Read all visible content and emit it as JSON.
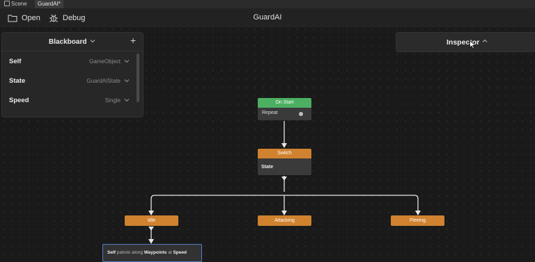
{
  "tabs": [
    {
      "label": "Scene",
      "active": false
    },
    {
      "label": "GuardAI*",
      "active": true
    }
  ],
  "toolbar": {
    "open_label": "Open",
    "debug_label": "Debug",
    "title": "GuardAI"
  },
  "blackboard": {
    "title": "Blackboard",
    "add_icon": "plus-icon",
    "rows": [
      {
        "name": "Self",
        "type": "GameObject"
      },
      {
        "name": "State",
        "type": "GuardAIState"
      },
      {
        "name": "Speed",
        "type": "Single"
      }
    ]
  },
  "inspector": {
    "title": "Inspector"
  },
  "graph": {
    "start": {
      "title": "On Start",
      "repeat_label": "Repeat"
    },
    "switch": {
      "title": "Switch",
      "param": "State"
    },
    "leaves": [
      "Idle",
      "Attacking",
      "Fleeing"
    ],
    "action": {
      "word1": "Self",
      "word2": "patrols along",
      "word3": "Waypoints",
      "word4": "at",
      "word5": "Speed"
    }
  },
  "colors": {
    "start": "#4caf62",
    "node": "#d0822f",
    "selection": "#4f7ec4"
  }
}
